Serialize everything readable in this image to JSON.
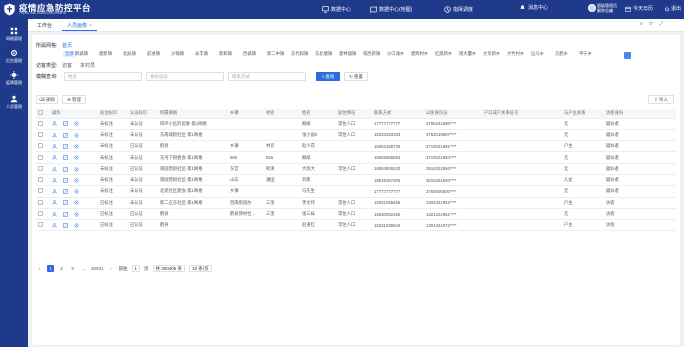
{
  "app": {
    "title": "疫情应急防控平台",
    "subtitle": "YI QING YING JI FANG KONG PING TAI"
  },
  "topnav": [
    {
      "label": "数据中心",
      "icon": "monitor-icon"
    },
    {
      "label": "数据中心(地图)",
      "icon": "map-icon"
    },
    {
      "label": "指挥调度",
      "icon": "dispatch-icon"
    }
  ],
  "header": {
    "messages_label": "消息中心",
    "user_name_line1": "超级管理员",
    "user_name_line2": "解除总编",
    "weekday": "今天日历",
    "logout": "退出"
  },
  "sidebar": [
    {
      "label": "网格管理",
      "icon": "grid-icon"
    },
    {
      "label": "后台管理",
      "icon": "settings-icon"
    },
    {
      "label": "疫情管理",
      "icon": "virus-icon"
    },
    {
      "label": "人员管理",
      "icon": "people-icon"
    }
  ],
  "tabs": [
    {
      "label": "工作台",
      "active": false
    },
    {
      "label": "人员画像",
      "active": true
    }
  ],
  "filters": {
    "area_label": "所属网格:",
    "area_selected": "首页",
    "towns": [
      "全部",
      "鹤城镇",
      "建新镇",
      "北辰镇",
      "前进镇",
      "沙锦镇",
      "永丰镇",
      "新和镇",
      "西城镇",
      "新二中镇",
      "东代和镇",
      "东北塘镇",
      "建林铺镇",
      "南西新镇",
      "沙口滩乡",
      "碧辉村乡",
      "红旗新乡",
      "南大鏖乡",
      "大亲新乡",
      "大竹村乡",
      "远马乡",
      "元鹤乡",
      "平宁乡"
    ],
    "type_label": "访客类型:",
    "types": [
      "访客",
      "本村员"
    ],
    "search_label": "模糊查询:",
    "placeholders": [
      "姓名",
      "身份证号",
      "联系方式"
    ],
    "query_button": "查询",
    "reset_button": "重置"
  },
  "toolbar": {
    "delete_label": "删除",
    "manage_label": "管理",
    "import_label": "导入"
  },
  "table": {
    "columns": [
      "",
      "操作",
      "标注标识",
      "认证标识",
      "所属网格",
      "乡镇",
      "村名",
      "姓名",
      "居住情况",
      "联系方式",
      "公民身份证",
      "户口成户关系证号",
      "与户主关系",
      "访客身份"
    ],
    "rows": [
      [
        "未标注",
        "未认证",
        "四环小区的居委-第1网格",
        "",
        "",
        "顾斌",
        "常住人口",
        "17777777777",
        "3765231996****",
        "",
        "无",
        "疑似者"
      ],
      [
        "未标注",
        "未认证",
        "东南城街社区-第1网格",
        "",
        "",
        "张小丽2",
        "常住人口",
        "15333333333",
        "3762019967****",
        "",
        "无",
        "疑似者"
      ],
      [
        "未标注",
        "已认证",
        "鹤县",
        "乡镇",
        "村名",
        "赵小花",
        "",
        "15063168735",
        "3710021991****",
        "",
        "户主",
        "疑似者"
      ],
      [
        "未标注",
        "未认证",
        "东河下街委会-第1网格",
        "555",
        "555",
        "顾斌",
        "",
        "15555555554",
        "3710021994****",
        "",
        "无",
        "疑似者"
      ],
      [
        "未标注",
        "已认证",
        "南国营街社区-第1网格",
        "东宫",
        "利津",
        "大叔大",
        "常住人口",
        "18554505533",
        "3515251994****",
        "",
        "无",
        "疑似者"
      ],
      [
        "未标注",
        "未认证",
        "南国营街社区-第1网格",
        "山东",
        "潘田",
        "刘斯",
        "",
        "18519187400",
        "3515251594****",
        "",
        "儿女",
        "疑似者"
      ],
      [
        "未标注",
        "未认证",
        "北苑社区委会-第1网格",
        "乡镇",
        "",
        "冯先生",
        "",
        "17777777777",
        "3760000000****",
        "",
        "无",
        "疑似者"
      ],
      [
        "已标注",
        "未认证",
        "新二庄东社区-第1网格",
        "西南街道办",
        "三里",
        "李文炜",
        "常住人口",
        "15031058466",
        "1304341952****",
        "",
        "户主",
        "访客"
      ],
      [
        "已标注",
        "已认证",
        "鹤县",
        "鹤县郭村社...",
        "三里",
        "张三妹",
        "常住人口",
        "16630092160",
        "1321221951****",
        "",
        "无",
        "访客"
      ],
      [
        "已标注",
        "已认证",
        "鹤县",
        "",
        "",
        "赵道红",
        "常住人口",
        "15031035943",
        "1304341972****",
        "",
        "户主",
        "访客"
      ]
    ]
  },
  "pagination": {
    "pages": [
      "1",
      "2",
      "3",
      "...",
      "30041"
    ],
    "current": "1",
    "goto_label": "前往",
    "goto_value": "1",
    "page_unit": "页",
    "total": "共 300405 条",
    "page_size": "10 条/页"
  },
  "watermark": "超级管理员 2024"
}
